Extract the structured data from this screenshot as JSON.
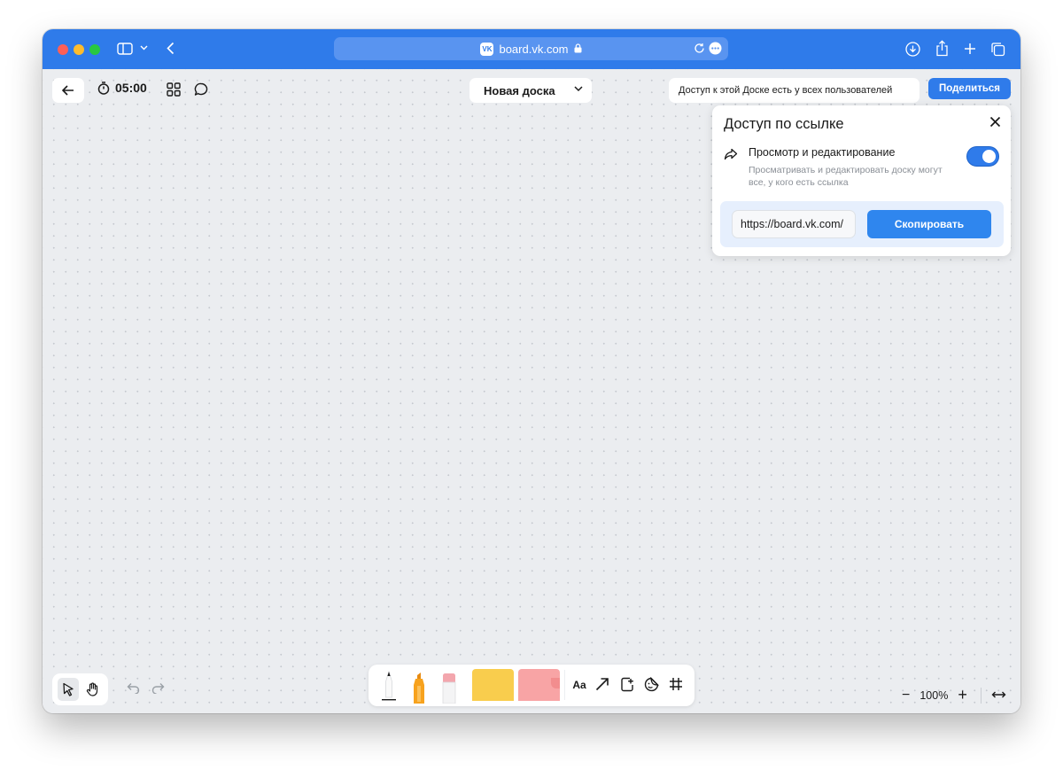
{
  "browser": {
    "url": "board.vk.com",
    "vk_badge": "VK"
  },
  "toolbar": {
    "timer": "05:00",
    "board_title": "Новая доска",
    "access_note": "Доступ к этой Доске есть у всех пользователей",
    "share_label": "Поделиться"
  },
  "popover": {
    "title": "Доступ по ссылке",
    "permission_title": "Просмотр и редактирование",
    "permission_desc": "Просматривать и редактировать доску могут все, у кого есть ссылка",
    "toggle_on": true,
    "link_value": "https://board.vk.com/",
    "copy_label": "Скопировать"
  },
  "bottom": {
    "text_tool_label": "Aa",
    "zoom_minus": "−",
    "zoom_level": "100%",
    "zoom_plus": "+"
  },
  "colors": {
    "accent": "#2f7bea",
    "sticky_yellow": "#f9cd4d",
    "sticky_pink": "#f8a4a5"
  }
}
